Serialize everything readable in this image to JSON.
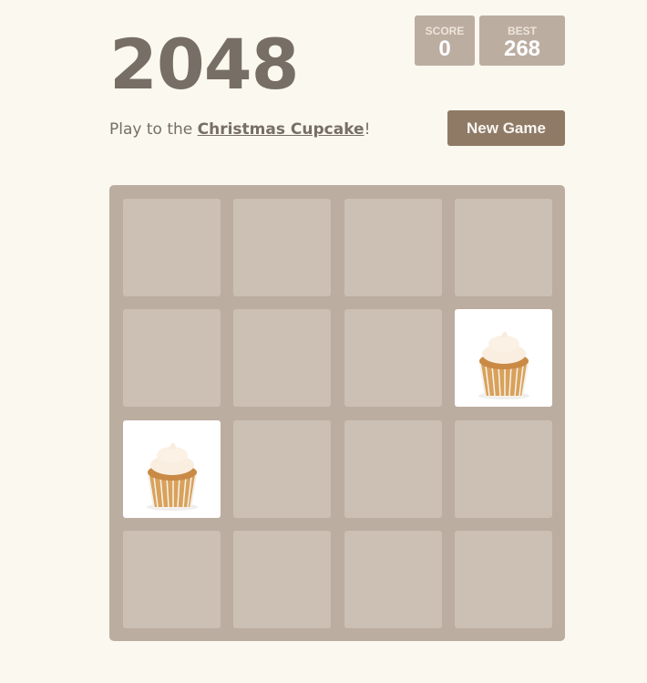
{
  "header": {
    "title": "2048",
    "score_label": "SCORE",
    "score": "0",
    "best_label": "BEST",
    "best": "268"
  },
  "intro": {
    "prefix": "Play to the ",
    "goal": "Christmas Cupcake",
    "suffix": "!"
  },
  "controls": {
    "new_game_label": "New Game"
  },
  "board": {
    "size": 4,
    "tiles": [
      {
        "row": 1,
        "col": 3,
        "image": "cupcake"
      },
      {
        "row": 2,
        "col": 0,
        "image": "cupcake"
      }
    ]
  },
  "colors": {
    "background": "#faf8ef",
    "board": "#bbada0",
    "button": "#8f7a66",
    "text": "#776e65"
  }
}
